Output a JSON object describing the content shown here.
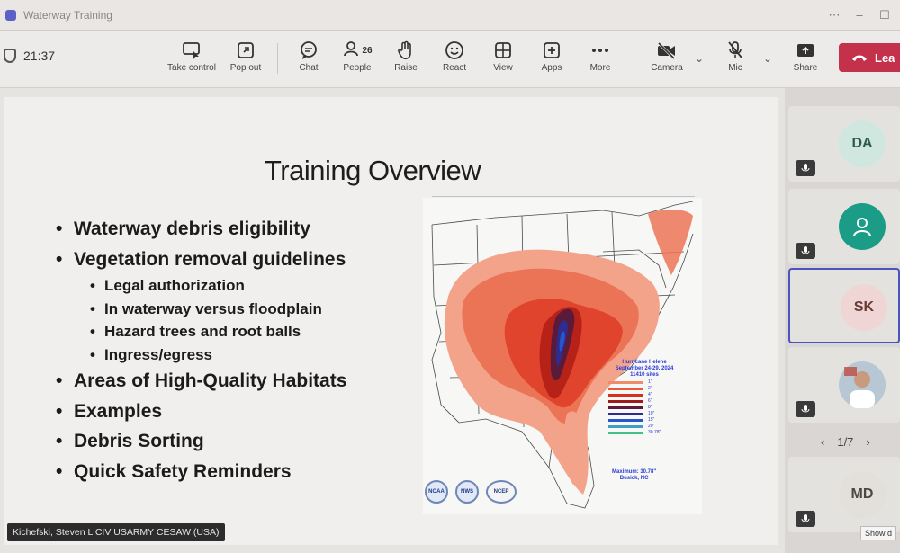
{
  "window": {
    "title": "Waterway Training"
  },
  "toolbar": {
    "timer": "21:37",
    "buttons": [
      {
        "id": "take-control",
        "label": "Take control"
      },
      {
        "id": "pop-out",
        "label": "Pop out"
      },
      {
        "id": "chat",
        "label": "Chat"
      },
      {
        "id": "people",
        "label": "People",
        "count": "26"
      },
      {
        "id": "raise",
        "label": "Raise"
      },
      {
        "id": "react",
        "label": "React"
      },
      {
        "id": "view",
        "label": "View"
      },
      {
        "id": "apps",
        "label": "Apps"
      },
      {
        "id": "more",
        "label": "More"
      },
      {
        "id": "camera",
        "label": "Camera"
      },
      {
        "id": "mic",
        "label": "Mic"
      },
      {
        "id": "share",
        "label": "Share"
      }
    ],
    "leave_label": "Lea"
  },
  "slide": {
    "title": "Training Overview",
    "bullets": [
      {
        "text": "Waterway debris eligibility",
        "level": 1
      },
      {
        "text": "Vegetation removal guidelines",
        "level": 1
      },
      {
        "text": "Legal authorization",
        "level": 2
      },
      {
        "text": "In waterway versus floodplain",
        "level": 2
      },
      {
        "text": "Hazard trees and root balls",
        "level": 2
      },
      {
        "text": "Ingress/egress",
        "level": 2
      },
      {
        "text": "Areas of High-Quality Habitats",
        "level": 1
      },
      {
        "text": "Examples",
        "level": 1
      },
      {
        "text": "Debris Sorting",
        "level": 1
      },
      {
        "text": "Quick Safety Reminders",
        "level": 1
      }
    ],
    "map": {
      "legend_title": [
        "Hurricane Helene",
        "September 24-29, 2024",
        "11410 sites"
      ],
      "legend_colors": [
        "#f28b6a",
        "#e85a3c",
        "#d4321e",
        "#9c1c1c",
        "#5a1a3a",
        "#2e2d8f",
        "#2a55c9",
        "#3aa0c8",
        "#43c08a"
      ],
      "legend_values": [
        "1\"",
        "2\"",
        "4\"",
        "6\"",
        "8\"",
        "10\"",
        "15\"",
        "20\"",
        "30.78\""
      ],
      "note": [
        "Maximum: 30.78\"",
        "Busick, NC"
      ],
      "logos": [
        "NOAA",
        "NWS",
        "NCEP"
      ]
    }
  },
  "presenter": {
    "name": "Kichefski, Steven L CIV USARMY CESAW (USA)"
  },
  "participants": [
    {
      "initials": "DA",
      "bg": "#cfe7de",
      "fg": "#2f5a4e"
    },
    {
      "initials": "",
      "bg": "#1b9c86",
      "fg": "#ffffff",
      "icon": "person-icon"
    },
    {
      "initials": "SK",
      "bg": "#efd6d4",
      "fg": "#6a3a36",
      "active": true
    },
    {
      "initials": "",
      "bg": "#b7c7d3",
      "fg": "#ffffff",
      "photo": true
    },
    {
      "initials": "MD",
      "bg": "#e3e0dc",
      "fg": "#4b4743"
    }
  ],
  "pager": {
    "label": "1/7"
  },
  "show_label": "Show d"
}
